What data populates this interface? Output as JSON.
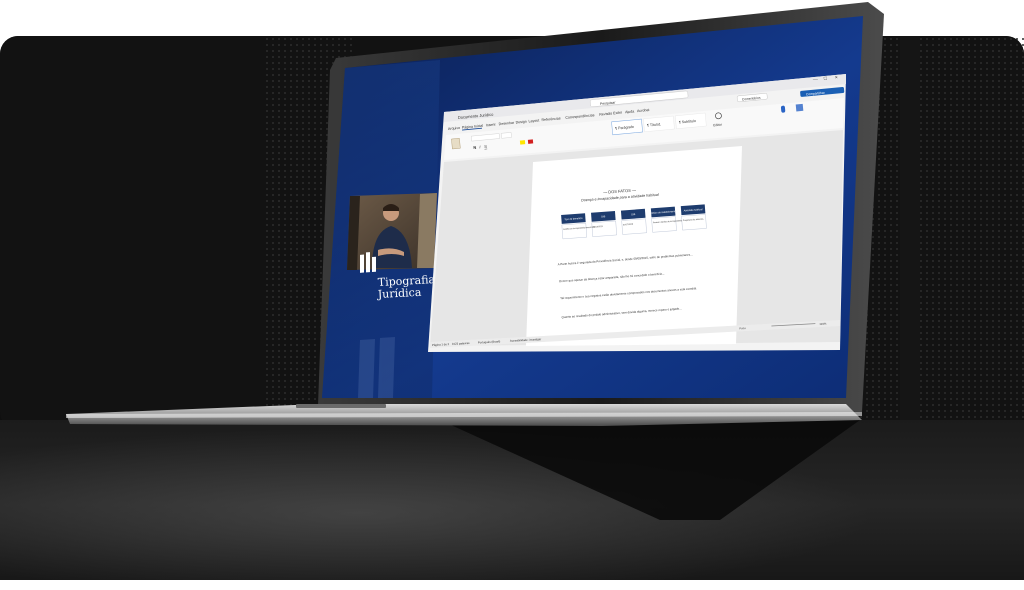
{
  "brand": {
    "line1": "Tipografia",
    "line2": "Jurídica"
  },
  "word": {
    "title": "Documento Jurídico",
    "search_placeholder": "Pesquisar",
    "menu_tabs": [
      "Arquivo",
      "Página Inicial",
      "Inserir",
      "Desenhar",
      "Design",
      "Layout",
      "Referências",
      "Correspondências",
      "Revisão",
      "Exibir",
      "Ajuda",
      "Acrobat"
    ],
    "active_tab_index": 1,
    "styles": [
      "¶ Parágrafo",
      "¶ Título1",
      "¶ Subtítulo"
    ],
    "editing_label": "Editar",
    "share_label": "Compartilhar",
    "comments_label": "Comentários",
    "status_page": "Página 1 de 2",
    "status_words": "1023 palavras",
    "status_lang": "Português (Brasil)",
    "status_accessibility": "Acessibilidade: investigar",
    "status_focus": "Foco",
    "zoom": "110%"
  },
  "document": {
    "heading": "— DOS FATOS —",
    "subheading": "Doença e incapacidade para a atividade habitual",
    "table_headers": [
      "Tipo de benefício",
      "DIB",
      "DIB",
      "Motivo do indeferimento",
      "Atividade habitual"
    ],
    "table_values": [
      "Auxílio por incapacidade temporária",
      "03/10/2021",
      "01/07/2026",
      "Parecer médico de incapacidade",
      "Carpinteiro de telhados"
    ],
    "paragraphs": [
      "A Parte Autora é segurada da Previdência Social, e, desde 09/09/2015, sofre de problemas pulmonares...",
      "Ocorre que apesar da doença estar amparada, não lhe foi concedido o benefício...",
      "Tal requerimento e sua negativa estão devidamente comprovados nos documentos anexos a esta exordial.",
      "Quanto ao resultado do pedido administrativo, sem dúvida alguma, merece reparo o julgado..."
    ]
  }
}
